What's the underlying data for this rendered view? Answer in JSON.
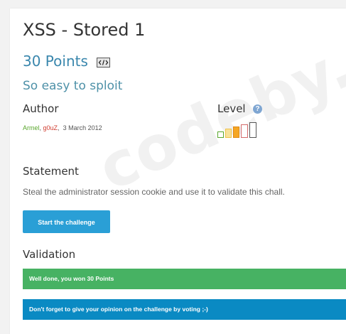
{
  "watermark": "codeby.net",
  "challenge": {
    "title": "XSS - Stored 1",
    "points": "30 Points",
    "subtitle": "So easy to sploit"
  },
  "icons": {
    "code": "code-icon",
    "help": "help-icon"
  },
  "author": {
    "heading": "Author",
    "names": [
      "Armel",
      "g0uZ"
    ],
    "date": "3 March 2012"
  },
  "level": {
    "heading": "Level",
    "help_glyph": "?",
    "value": 3,
    "max": 5
  },
  "statement": {
    "heading": "Statement",
    "text": "Steal the administrator session cookie and use it to validate this chall."
  },
  "start_button": {
    "label": "Start the challenge"
  },
  "validation": {
    "heading": "Validation",
    "success_message": "Well done, you won 30 Points",
    "info_message": "Don't forget to give your opinion on the challenge by voting ;-)"
  },
  "colors": {
    "accent": "#3a87ad",
    "button": "#2a9fd6",
    "success": "#47b263",
    "info": "#0a8ac3"
  }
}
